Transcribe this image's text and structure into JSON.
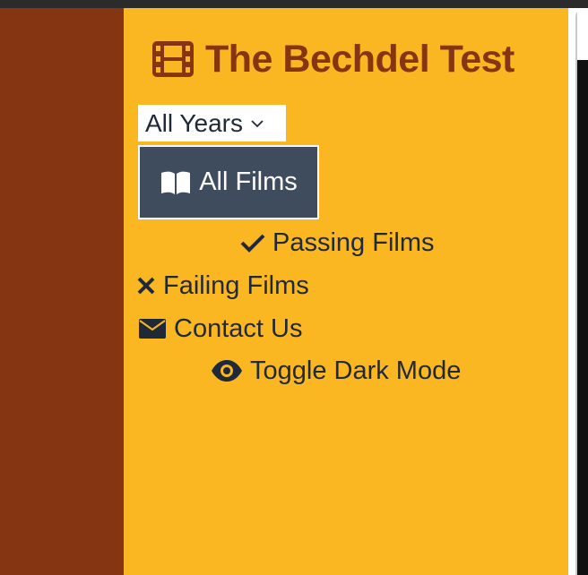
{
  "colors": {
    "left_panel": "#853511",
    "sidebar_bg": "#fbb721",
    "title_text": "#853511",
    "active_button_bg": "#3f4c5e",
    "nav_text": "#1f2937"
  },
  "header": {
    "title": "The Bechdel Test",
    "icon": "film-icon"
  },
  "filter": {
    "year_select": {
      "selected": "All Years",
      "icon": "chevron-down-icon"
    }
  },
  "nav": {
    "all_films": {
      "label": "All Films",
      "icon": "book-open-icon",
      "active": true
    },
    "passing": {
      "label": "Passing Films",
      "icon": "check-icon"
    },
    "failing": {
      "label": "Failing Films",
      "icon": "x-icon"
    },
    "contact": {
      "label": "Contact Us",
      "icon": "envelope-icon"
    },
    "dark_mode": {
      "label": "Toggle Dark Mode",
      "icon": "eye-icon"
    }
  }
}
